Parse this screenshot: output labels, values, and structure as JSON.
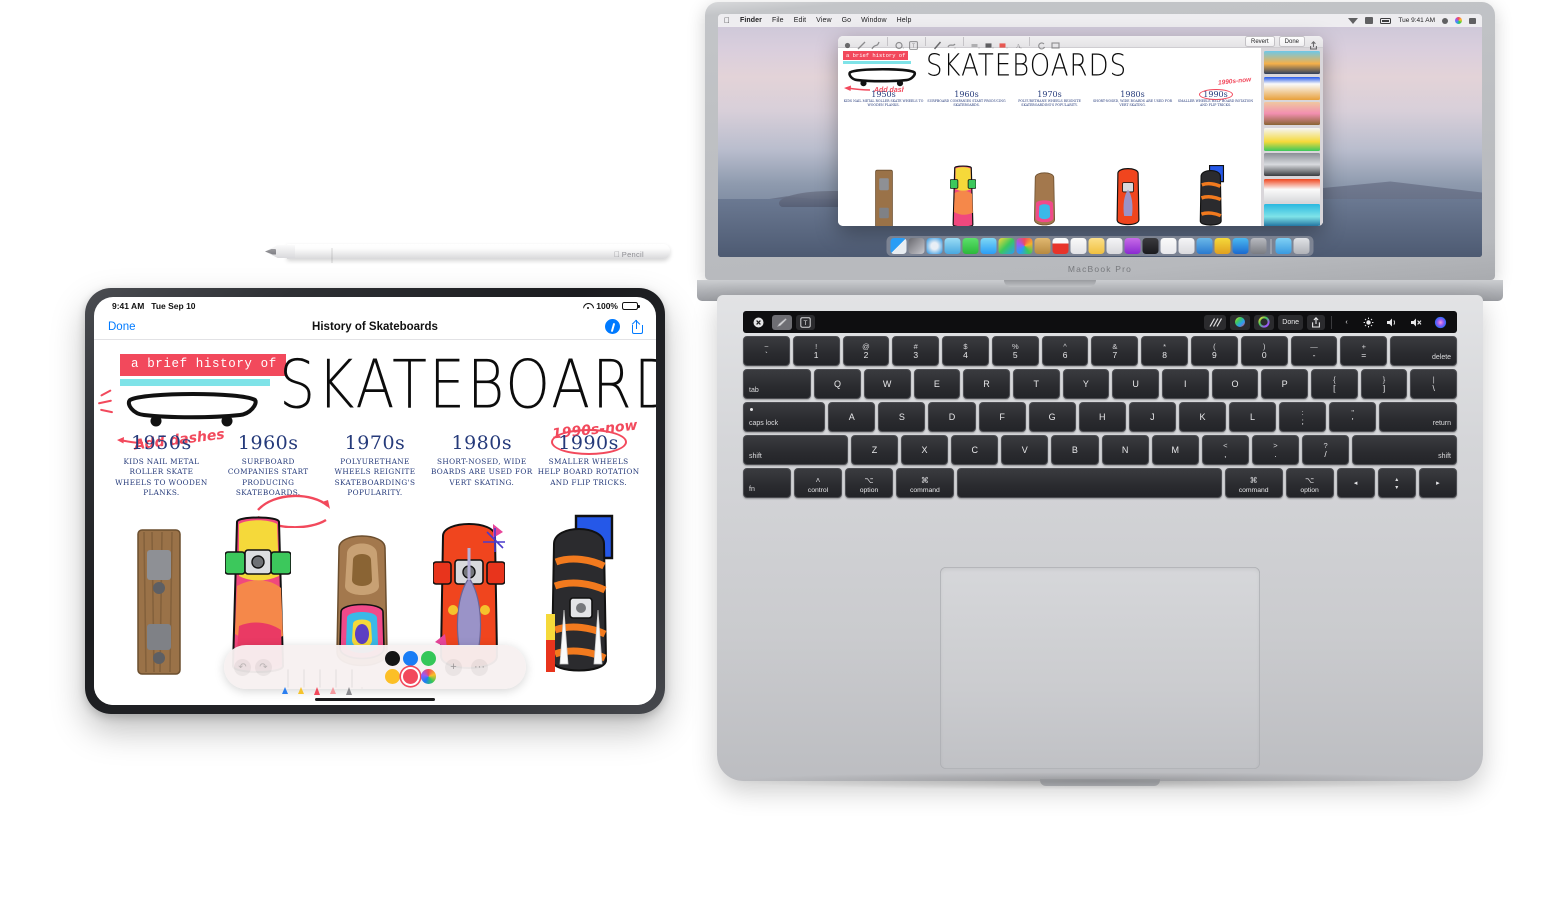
{
  "scene": {
    "devices": [
      "Apple Pencil",
      "iPad Pro",
      "MacBook Pro"
    ]
  },
  "pencil": {
    "label": "Pencil",
    "apple_glyph": "",
    "name": "apple-pencil"
  },
  "ipad": {
    "status_bar": {
      "time": "9:41 AM",
      "date": "Tue Sep 10",
      "battery_percent": "100%",
      "wifi_icon": "wifi-icon",
      "battery_icon": "battery-icon"
    },
    "nav": {
      "done_label": "Done",
      "title": "History of Skateboards",
      "markup_icon": "markup-pen-icon",
      "share_icon": "share-icon"
    },
    "document": {
      "tag": "a brief history of",
      "title": "SKATEBOARDS",
      "annotation_add_dashes": "Add dashes",
      "annotation_1990s_now": "1990s-now",
      "decades": [
        {
          "year": "1950s",
          "text": "KIDS NAIL METAL ROLLER SKATE WHEELS TO WOODEN PLANKS."
        },
        {
          "year": "1960s",
          "text": "SURFBOARD COMPANIES START PRODUCING SKATEBOARDS."
        },
        {
          "year": "1970s",
          "text": "POLYURETHANE WHEELS REIGNITE SKATEBOARDING'S POPULARITY."
        },
        {
          "year": "1980s",
          "text": "SHORT-NOSED, WIDE BOARDS ARE USED FOR VERT SKATING."
        },
        {
          "year": "1990s",
          "text": "SMALLER WHEELS HELP BOARD ROTATION AND FLIP TRICKS."
        }
      ]
    },
    "markup_toolbar": {
      "undo_icon": "undo-icon",
      "redo_icon": "redo-icon",
      "tools": [
        "pen-tool",
        "highlighter-tool",
        "marker-tool",
        "eraser-tool",
        "lasso-tool",
        "ruler-tool"
      ],
      "colors": [
        "#111111",
        "#1a7df5",
        "#35c759",
        "#f5b game",
        "#f2495c",
        "#rainbow"
      ],
      "swatches": [
        "#141414",
        "#1a7df5",
        "#35c759",
        "#fcbf26",
        "#f2495c",
        "rainbow"
      ],
      "selected_color": "#f2495c",
      "add_label": "+",
      "more_label": "···"
    }
  },
  "macbook": {
    "model_label": "MacBook Pro",
    "menubar": {
      "apple_glyph": "",
      "items": [
        "Finder",
        "File",
        "Edit",
        "View",
        "Go",
        "Window",
        "Help"
      ],
      "clock": "Tue 9:41 AM",
      "right_icons": [
        "wifi-icon",
        "airplay-icon",
        "battery-icon",
        "spotlight-icon",
        "siri-icon",
        "control-center-icon"
      ]
    },
    "quicklook": {
      "revert_label": "Revert",
      "done_label": "Done",
      "share_icon": "share-icon",
      "tools": [
        "sketch-icon",
        "draw-icon",
        "shapes-icon",
        "text-icon",
        "sign-icon",
        "annotate-icon",
        "shape-style-icon",
        "border-color-icon",
        "fill-color-icon",
        "text-style-icon",
        "rotate-icon",
        "crop-icon"
      ],
      "document": {
        "tag": "a brief history of",
        "title": "SKATEBOARDS",
        "annotation_1990s_now": "1990s-now",
        "decades": [
          {
            "year": "1950s",
            "text": "KIDS NAIL METAL ROLLER SKATE WHEELS TO WOODEN PLANKS."
          },
          {
            "year": "1960s",
            "text": "SURFBOARD COMPANIES START PRODUCING SKATEBOARDS."
          },
          {
            "year": "1970s",
            "text": "POLYURETHANE WHEELS REIGNITE SKATEBOARDING'S POPULARITY."
          },
          {
            "year": "1980s",
            "text": "SHORT-NOSED, WIDE BOARDS ARE USED FOR VERT SKATING."
          },
          {
            "year": "1990s",
            "text": "SMALLER WHEELS HELP BOARD ROTATION AND FLIP TRICKS."
          }
        ]
      }
    },
    "touchbar": {
      "close_icon": "close-icon",
      "pen_icon": "pen-icon",
      "text_icon": "text-icon",
      "lines_icon": "lines-icon",
      "color_icon": "color-wheel-icon",
      "outline_icon": "outline-color-icon",
      "done_label": "Done",
      "share_icon": "share-icon",
      "expand_icon": "chevron-left-icon",
      "brightness_icon": "brightness-icon",
      "volume_icon": "volume-icon",
      "mute_icon": "mute-icon",
      "siri_icon": "siri-icon"
    },
    "keyboard": {
      "rows": [
        [
          {
            "type": "dual",
            "top": "~",
            "bot": "`"
          },
          {
            "type": "dual",
            "top": "!",
            "bot": "1"
          },
          {
            "type": "dual",
            "top": "@",
            "bot": "2"
          },
          {
            "type": "dual",
            "top": "#",
            "bot": "3"
          },
          {
            "type": "dual",
            "top": "$",
            "bot": "4"
          },
          {
            "type": "dual",
            "top": "%",
            "bot": "5"
          },
          {
            "type": "dual",
            "top": "^",
            "bot": "6"
          },
          {
            "type": "dual",
            "top": "&",
            "bot": "7"
          },
          {
            "type": "dual",
            "top": "*",
            "bot": "8"
          },
          {
            "type": "dual",
            "top": "(",
            "bot": "9"
          },
          {
            "type": "dual",
            "top": ")",
            "bot": "0"
          },
          {
            "type": "dual",
            "top": "—",
            "bot": "-"
          },
          {
            "type": "dual",
            "top": "+",
            "bot": "="
          },
          {
            "type": "corner-br",
            "label": "delete",
            "cls": "k-wide"
          }
        ],
        [
          {
            "type": "corner-bl",
            "label": "tab",
            "cls": "k-tab"
          },
          {
            "type": "single",
            "label": "Q"
          },
          {
            "type": "single",
            "label": "W"
          },
          {
            "type": "single",
            "label": "E"
          },
          {
            "type": "single",
            "label": "R"
          },
          {
            "type": "single",
            "label": "T"
          },
          {
            "type": "single",
            "label": "Y"
          },
          {
            "type": "single",
            "label": "U"
          },
          {
            "type": "single",
            "label": "I"
          },
          {
            "type": "single",
            "label": "O"
          },
          {
            "type": "single",
            "label": "P"
          },
          {
            "type": "dual",
            "top": "{",
            "bot": "["
          },
          {
            "type": "dual",
            "top": "}",
            "bot": "]"
          },
          {
            "type": "dual",
            "top": "|",
            "bot": "\\"
          }
        ],
        [
          {
            "type": "caps",
            "label": "caps lock",
            "cls": "k-caps"
          },
          {
            "type": "single",
            "label": "A"
          },
          {
            "type": "single",
            "label": "S"
          },
          {
            "type": "single",
            "label": "D"
          },
          {
            "type": "single",
            "label": "F"
          },
          {
            "type": "single",
            "label": "G"
          },
          {
            "type": "single",
            "label": "H"
          },
          {
            "type": "single",
            "label": "J"
          },
          {
            "type": "single",
            "label": "K"
          },
          {
            "type": "single",
            "label": "L"
          },
          {
            "type": "dual",
            "top": ":",
            "bot": ";"
          },
          {
            "type": "dual",
            "top": "\"",
            "bot": "'"
          },
          {
            "type": "corner-br",
            "label": "return",
            "cls": "k-return"
          }
        ],
        [
          {
            "type": "corner-bl",
            "label": "shift",
            "cls": "k-shift-l"
          },
          {
            "type": "single",
            "label": "Z"
          },
          {
            "type": "single",
            "label": "X"
          },
          {
            "type": "single",
            "label": "C"
          },
          {
            "type": "single",
            "label": "V"
          },
          {
            "type": "single",
            "label": "B"
          },
          {
            "type": "single",
            "label": "N"
          },
          {
            "type": "single",
            "label": "M"
          },
          {
            "type": "dual",
            "top": "<",
            "bot": ","
          },
          {
            "type": "dual",
            "top": ">",
            "bot": "."
          },
          {
            "type": "dual",
            "top": "?",
            "bot": "/"
          },
          {
            "type": "corner-br",
            "label": "shift",
            "cls": "k-shift-r"
          }
        ],
        [
          {
            "type": "corner-bl",
            "label": "fn",
            "cls": "k-fn"
          },
          {
            "type": "mod",
            "sym": "˄",
            "label": "control",
            "cls": "k-ctrl"
          },
          {
            "type": "mod",
            "sym": "⌥",
            "label": "option",
            "cls": "k-opt"
          },
          {
            "type": "mod",
            "sym": "⌘",
            "label": "command",
            "cls": "k-cmd"
          },
          {
            "type": "space",
            "label": "",
            "cls": "k-space"
          },
          {
            "type": "mod",
            "sym": "⌘",
            "label": "command",
            "cls": "k-cmd"
          },
          {
            "type": "mod",
            "sym": "⌥",
            "label": "option",
            "cls": "k-opt"
          },
          {
            "type": "single",
            "label": "◂",
            "cls": "k-arrow"
          },
          {
            "type": "arrows-ud",
            "up": "▴",
            "down": "▾",
            "cls": "k-arrow-ud"
          },
          {
            "type": "single",
            "label": "▸",
            "cls": "k-arrow"
          }
        ]
      ]
    }
  }
}
